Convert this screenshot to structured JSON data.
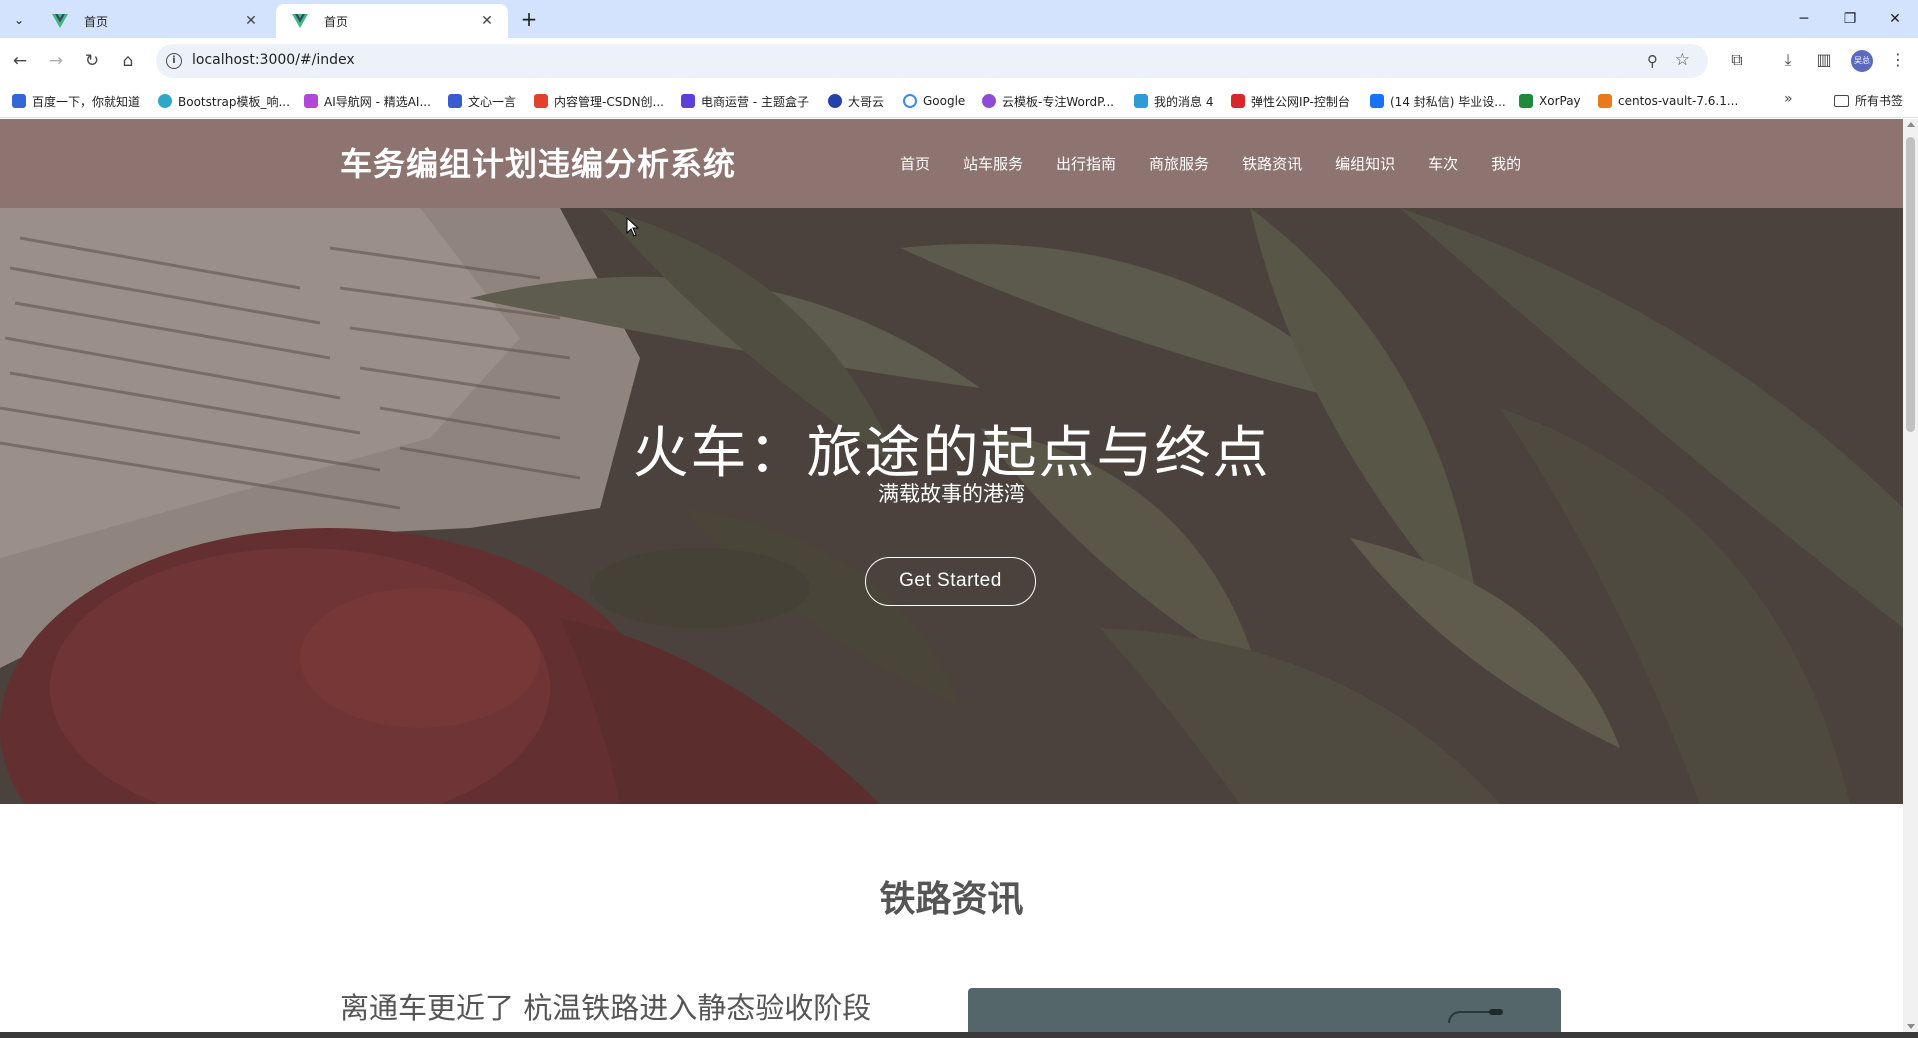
{
  "browser": {
    "tabs": [
      {
        "title": "首页",
        "active": false
      },
      {
        "title": "首页",
        "active": true
      }
    ],
    "url": "localhost:3000/#/index",
    "profile_initials": "吴总",
    "bookmarks": [
      {
        "label": "百度一下，你就知道",
        "color": "#3466d6"
      },
      {
        "label": "Bootstrap模板_响...",
        "color": "#2fa8c8"
      },
      {
        "label": "AI导航网 - 精选AI...",
        "color": "#b04ad6"
      },
      {
        "label": "文心一言",
        "color": "#3a5bd0"
      },
      {
        "label": "内容管理-CSDN创...",
        "color": "#e0412c"
      },
      {
        "label": "电商运营 - 主题盒子",
        "color": "#5b3fd8"
      },
      {
        "label": "大哥云",
        "color": "#2242a8"
      },
      {
        "label": "Google",
        "color": "#4285f4"
      },
      {
        "label": "云模板-专注WordP...",
        "color": "#8d4bd6"
      },
      {
        "label": "我的消息 4",
        "color": "#2f9bd6"
      },
      {
        "label": "弹性公网IP-控制台",
        "color": "#d8262b"
      },
      {
        "label": "(14 封私信) 毕业设...",
        "color": "#1772f6"
      },
      {
        "label": "XorPay",
        "color": "#1f8a3a"
      },
      {
        "label": "centos-vault-7.6.1...",
        "color": "#e87a1c"
      }
    ],
    "all_bookmarks_label": "所有书签"
  },
  "site": {
    "title": "车务编组计划违编分析系统",
    "nav": [
      "首页",
      "站车服务",
      "出行指南",
      "商旅服务",
      "铁路资讯",
      "编组知识",
      "车次",
      "我的"
    ]
  },
  "hero": {
    "title": "火车：旅途的起点与终点",
    "subtitle": "满载故事的港湾",
    "button_label": "Get Started"
  },
  "news_section": {
    "title": "铁路资讯",
    "first_item_title": "离通车更近了 杭温铁路进入静态验收阶段"
  },
  "colors": {
    "header_bg": "#8e7470",
    "tabbar_bg": "#d3e3fd"
  }
}
